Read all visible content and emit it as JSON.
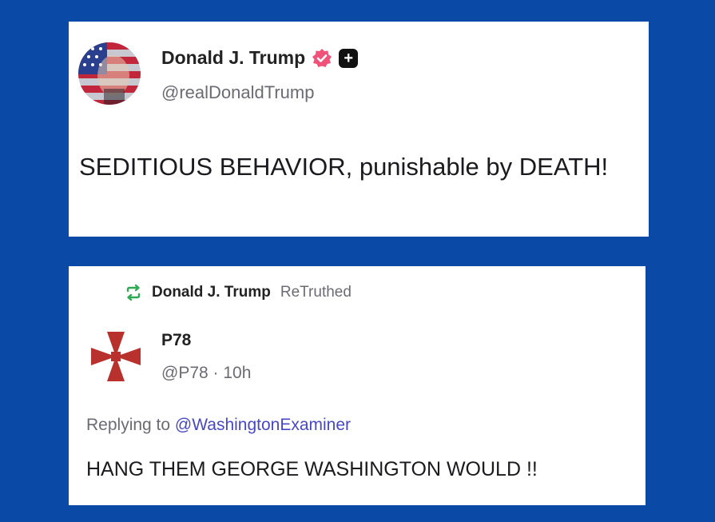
{
  "post": {
    "author_name": "Donald J. Trump",
    "author_handle": "@realDonaldTrump",
    "verified_icon": "verified-badge-icon",
    "plus_icon": "plus-badge-icon",
    "body": "SEDITIOUS BEHAVIOR, punishable by DEATH!"
  },
  "retruth": {
    "icon": "retruth-icon",
    "by_name": "Donald J. Trump",
    "label": "ReTruthed",
    "author_name": "P78",
    "author_handle": "@P78",
    "separator": "·",
    "time": "10h",
    "replying_prefix": "Replying to",
    "replying_to": "@WashingtonExaminer",
    "body": "HANG THEM GEORGE WASHINGTON WOULD !!"
  },
  "colors": {
    "background": "#0a4aa6",
    "verified": "#f0527a",
    "retruth": "#2eaa55",
    "link": "#4848c7"
  }
}
